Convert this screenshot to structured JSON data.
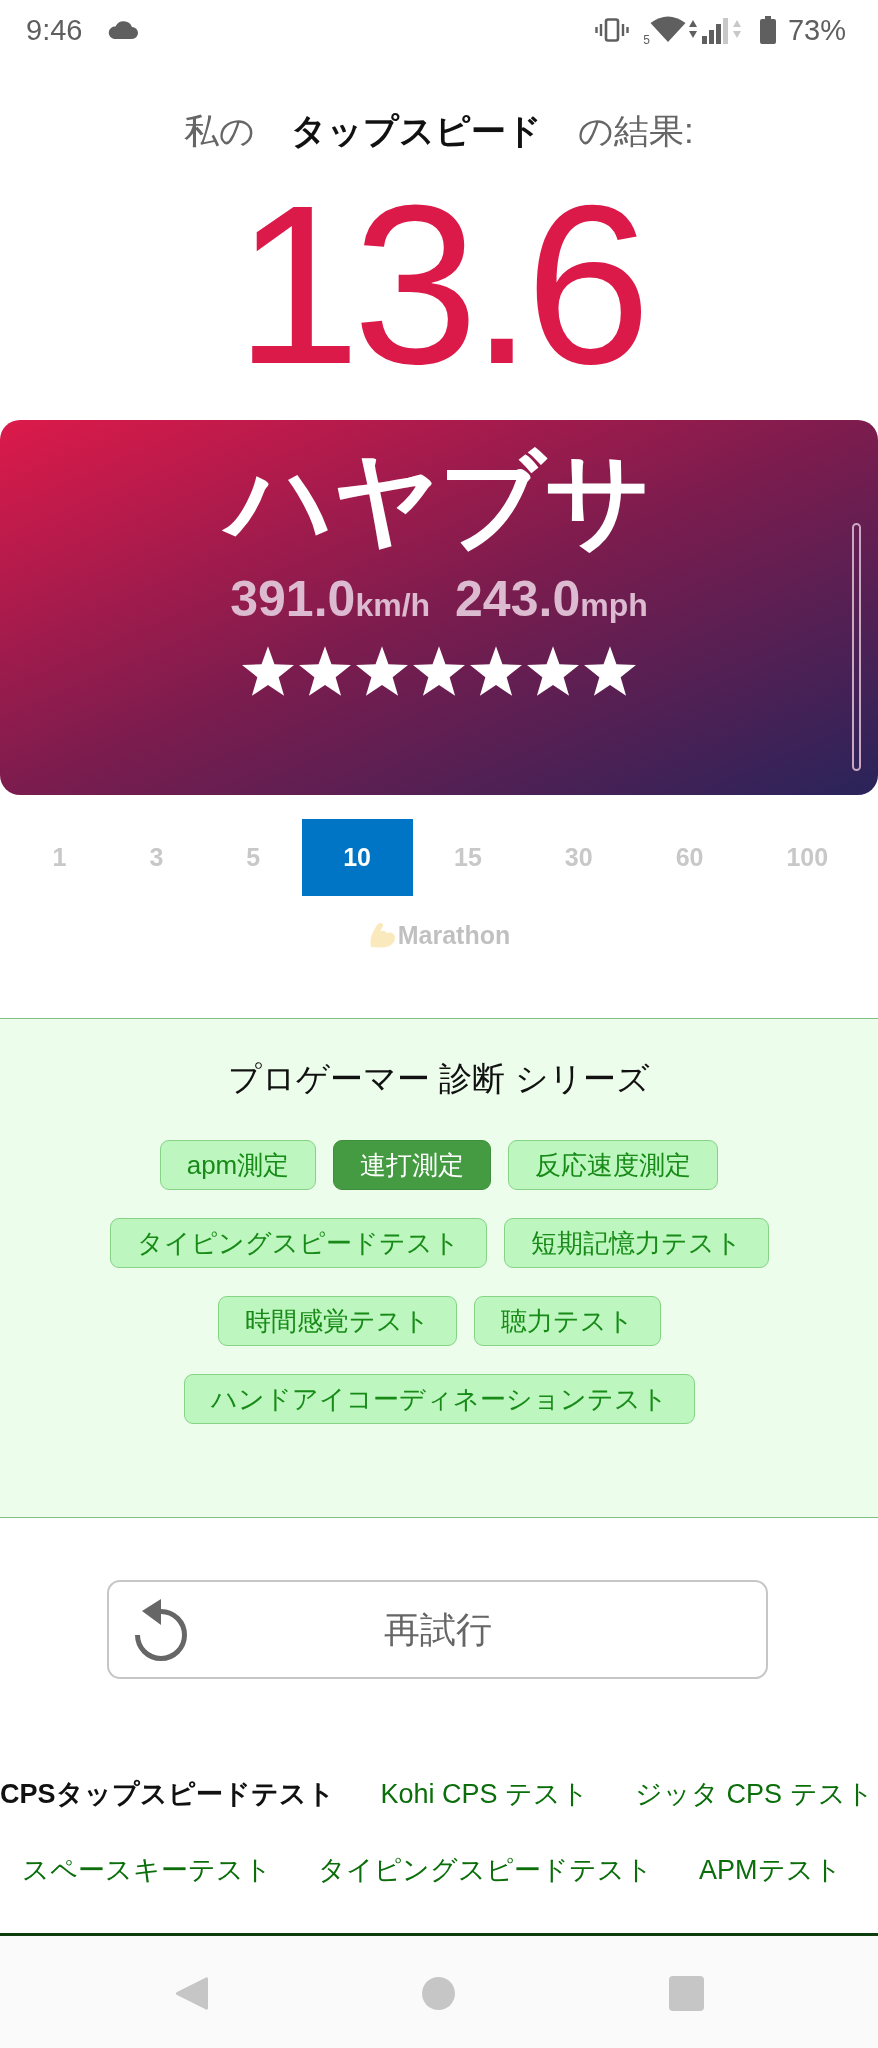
{
  "status_bar": {
    "time": "9:46",
    "wifi_standard": "5",
    "battery": "73%"
  },
  "result": {
    "heading": "私の **タップスピード** の結果:",
    "score": "13.6"
  },
  "rank_card": {
    "title": "ハヤブサ",
    "speeds": [
      {
        "value": "391.0",
        "unit": "km/h"
      },
      {
        "value": "243.0",
        "unit": "mph"
      }
    ],
    "stars": 7
  },
  "durations": [
    {
      "label": "1",
      "selected": false
    },
    {
      "label": "3",
      "selected": false
    },
    {
      "label": "5",
      "selected": false
    },
    {
      "label": "10",
      "selected": true
    },
    {
      "label": "15",
      "selected": false
    },
    {
      "label": "30",
      "selected": false
    },
    {
      "label": "60",
      "selected": false
    },
    {
      "label": "100",
      "selected": false
    }
  ],
  "marathon_toggle": {
    "label": "Marathon",
    "disabled": true
  },
  "series": {
    "title": "プロゲーマー 診断 シリーズ",
    "tags": [
      {
        "label": "apm測定",
        "selected": false
      },
      {
        "label": "連打測定",
        "selected": true
      },
      {
        "label": "反応速度測定",
        "selected": false
      },
      {
        "label": "タイピングスピードテスト",
        "selected": false
      },
      {
        "label": "短期記憶力テスト",
        "selected": false
      },
      {
        "label": "時間感覚テスト",
        "selected": false
      },
      {
        "label": "聴力テスト",
        "selected": false
      },
      {
        "label": "ハンドアイコーディネーションテスト",
        "selected": false
      }
    ]
  },
  "retry_button": {
    "label": "再試行"
  },
  "related_links": {
    "rows": [
      {
        "items": [
          {
            "label": "CPSタップスピードテスト",
            "selected": true
          },
          {
            "label": "Kohi CPS テスト",
            "selected": false
          },
          {
            "label": "ジッタ CPS テスト",
            "selected": false
          }
        ]
      },
      {
        "items": [
          {
            "label": "スペースキーテスト",
            "selected": false
          },
          {
            "label": "タイピングスピードテスト",
            "selected": false
          },
          {
            "label": "APMテスト",
            "selected": false
          }
        ]
      }
    ]
  }
}
